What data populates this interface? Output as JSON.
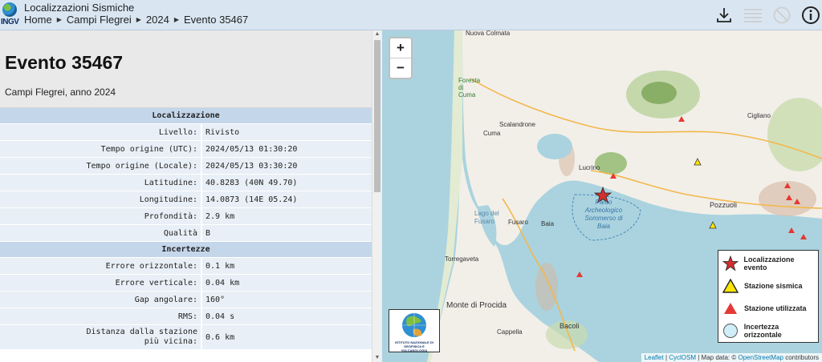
{
  "header": {
    "logo_text": "INGV",
    "app_title": "Localizzazioni Sismiche",
    "breadcrumb": [
      "Home",
      "Campi Flegrei",
      "2024",
      "Evento 35467"
    ],
    "icons": [
      "download-icon",
      "list-icon",
      "no-entry-icon",
      "info-icon"
    ]
  },
  "event": {
    "title": "Evento 35467",
    "subtitle": "Campi Flegrei, anno 2024"
  },
  "table": {
    "section_localization": "Localizzazione",
    "localization_rows": [
      {
        "label": "Livello:",
        "value": "Rivisto"
      },
      {
        "label": "Tempo origine (UTC):",
        "value": "2024/05/13 01:30:20"
      },
      {
        "label": "Tempo origine (Locale):",
        "value": "2024/05/13 03:30:20"
      },
      {
        "label": "Latitudine:",
        "value": "40.8283 (40N 49.70)"
      },
      {
        "label": "Longitudine:",
        "value": "14.0873 (14E 05.24)"
      },
      {
        "label": "Profondità:",
        "value": "2.9 km"
      },
      {
        "label": "Qualità",
        "value": "B"
      }
    ],
    "section_uncertainty": "Incertezze",
    "uncertainty_rows": [
      {
        "label": "Errore orizzontale:",
        "value": "0.1 km"
      },
      {
        "label": "Errore verticale:",
        "value": "0.04 km"
      },
      {
        "label": "Gap angolare:",
        "value": "160°"
      },
      {
        "label": "RMS:",
        "value": "0.04 s"
      },
      {
        "label": "Distanza dalla stazione\npiù vicina:",
        "value": "0.6 km"
      }
    ]
  },
  "map": {
    "zoom_in": "+",
    "zoom_out": "−",
    "place_labels": [
      "Nuova Colmata",
      "Foresta di Cuma",
      "Scalandrone",
      "Cuma",
      "Lucrino",
      "Parco Archeologico Sommerso di Baia",
      "Lago del Fusaro",
      "Fusaro",
      "Baia",
      "Pozzuoli",
      "Cigliano",
      "Torregaveta",
      "Monte di Procida",
      "Cappella",
      "Bacoli"
    ],
    "legend": {
      "event": "Localizzazione evento",
      "seismic_station": "Stazione sismica",
      "used_station": "Stazione utilizzata",
      "horizontal_uncertainty": "Incertezza orizzontale"
    },
    "badge_text": "ISTITUTO NAZIONALE DI GEOFISICA E VULCANOLOGIA",
    "attribution": {
      "leaflet": "Leaflet",
      "sep1": " | ",
      "cyclosm": "CyclOSM",
      "middle": " | Map data: © ",
      "osm": "OpenStreetMap",
      "end": " contributors"
    },
    "colors": {
      "sea": "#aad3df",
      "land": "#f2efe9",
      "relief": "#8fb86a",
      "event_star": "#d32f2f",
      "station_used": "#e53935",
      "station_seismic": "#ffe600"
    }
  }
}
